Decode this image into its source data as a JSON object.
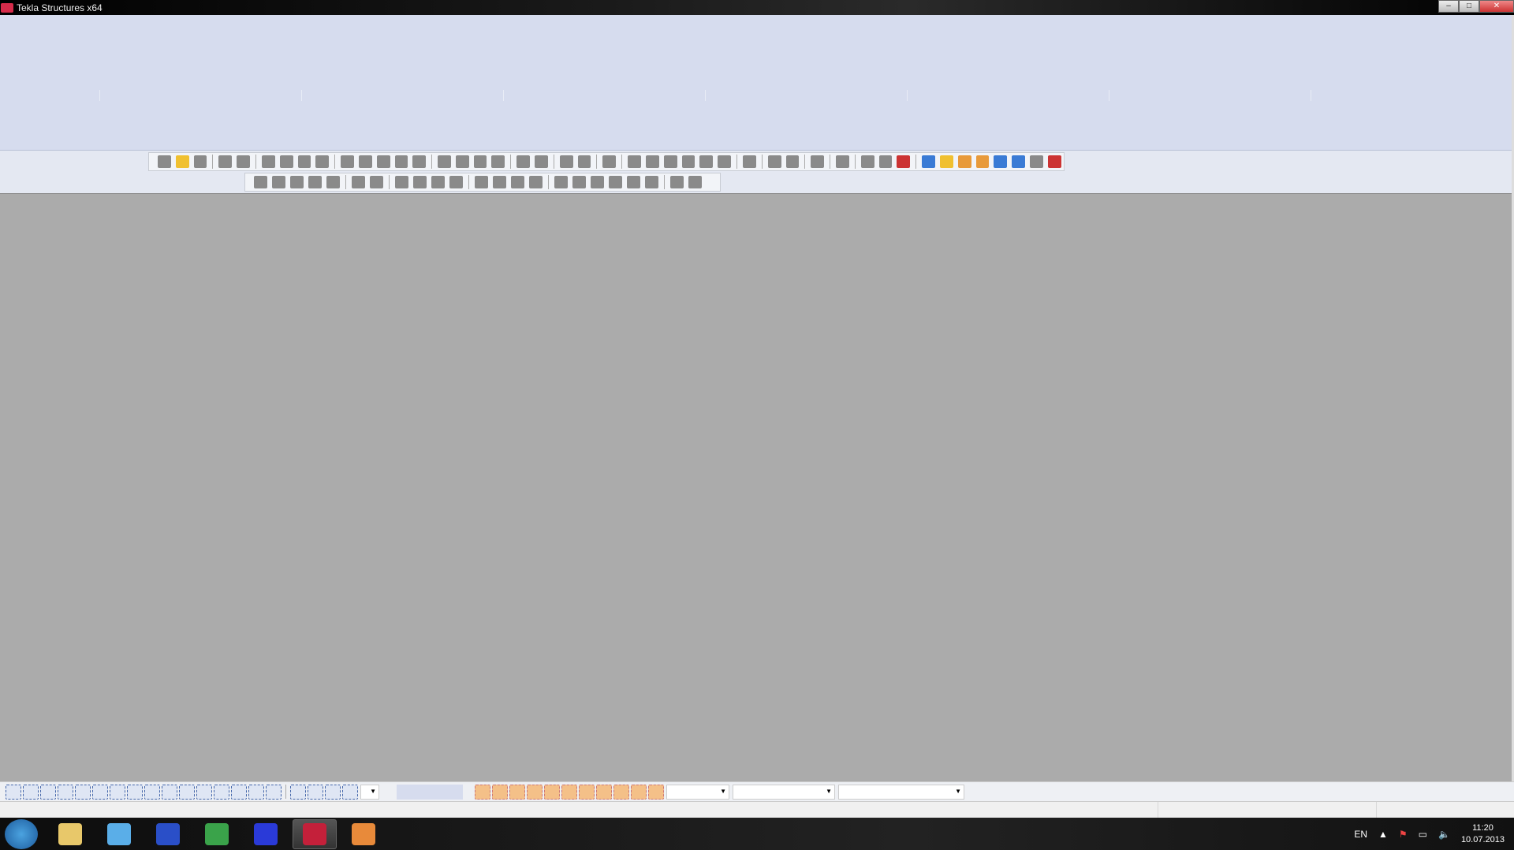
{
  "window": {
    "title": "Tekla Structures x64",
    "minimize": "–",
    "maximize": "□",
    "close": "✕"
  },
  "toolbar1": {
    "groups": [
      [
        "new-file-icon",
        "open-file-icon",
        "save-icon"
      ],
      [
        "undo-icon",
        "redo-icon"
      ],
      [
        "copy-icon",
        "move-icon",
        "delete-icon",
        "properties-icon"
      ],
      [
        "select-all-icon",
        "select-parts-icon",
        "select-objects-icon",
        "cut-icon",
        "rotate-icon"
      ],
      [
        "view-icon",
        "view2-icon",
        "view3-icon",
        "view4-icon"
      ],
      [
        "snap-icon",
        "snap2-icon"
      ],
      [
        "inquire-icon",
        "inquire2-icon"
      ],
      [
        "help-icon"
      ],
      [
        "grid-icon",
        "grid2-icon",
        "dimension-icon",
        "measure-icon",
        "arc-icon",
        "measure2-icon"
      ],
      [
        "zoom-icon"
      ],
      [
        "component-icon",
        "component2-icon"
      ],
      [
        "folder-icon"
      ],
      [
        "render-icon"
      ],
      [
        "forward-icon",
        "tool-icon",
        "shield-icon"
      ],
      [
        "clip-plane-icon",
        "open-folder-icon",
        "box-icon",
        "copy-box-icon",
        "comment-icon",
        "blue-box-icon",
        "bars-icon",
        "toggle-icon"
      ]
    ]
  },
  "toolbar2": {
    "groups": [
      [
        "column-icon",
        "beam-icon",
        "polybeam-icon",
        "curved-beam-icon",
        "slab-icon"
      ],
      [
        "twin-icon",
        "orthogonal-icon"
      ],
      [
        "pad-footing-icon",
        "strip-footing-icon",
        "concrete-column-icon",
        "concrete-panel-icon"
      ],
      [
        "bolt-icon",
        "weld-icon",
        "plate-icon",
        "detail-icon"
      ],
      [
        "point-icon",
        "point2-icon",
        "point3-icon",
        "point4-icon",
        "point5-icon",
        "point6-icon"
      ],
      [
        "line-point-icon",
        "circle-point-icon"
      ]
    ]
  },
  "bottombar": {
    "count_select": 16,
    "count_snap": 4,
    "count_orange": 11,
    "dropdowns": [
      "",
      "",
      ""
    ]
  },
  "taskbar": {
    "apps": [
      "explorer-icon",
      "calculator-icon",
      "seamonkey-icon",
      "chrome-icon",
      "snip-icon",
      "tekla-icon",
      "webcam-icon"
    ]
  },
  "tray": {
    "language": "EN",
    "time": "11:20",
    "date": "10.07.2013"
  }
}
